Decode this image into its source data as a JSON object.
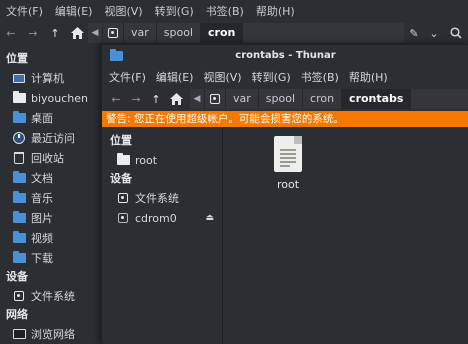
{
  "back_window": {
    "menu": [
      "文件(F)",
      "编辑(E)",
      "视图(V)",
      "转到(G)",
      "书签(B)",
      "帮助(H)"
    ],
    "path": [
      "var",
      "spool",
      "cron"
    ],
    "sidebar": {
      "places_title": "位置",
      "places": [
        {
          "label": "计算机",
          "icon": "computer-icon"
        },
        {
          "label": "biyouchen",
          "icon": "home-folder-icon"
        },
        {
          "label": "桌面",
          "icon": "desktop-folder-icon"
        },
        {
          "label": "最近访问",
          "icon": "recent-icon"
        },
        {
          "label": "回收站",
          "icon": "trash-icon"
        },
        {
          "label": "文档",
          "icon": "documents-folder-icon"
        },
        {
          "label": "音乐",
          "icon": "music-folder-icon"
        },
        {
          "label": "图片",
          "icon": "pictures-folder-icon"
        },
        {
          "label": "视频",
          "icon": "videos-folder-icon"
        },
        {
          "label": "下载",
          "icon": "downloads-folder-icon"
        }
      ],
      "devices_title": "设备",
      "devices": [
        {
          "label": "文件系统",
          "icon": "filesystem-icon"
        }
      ],
      "network_title": "网络",
      "network": [
        {
          "label": "浏览网络",
          "icon": "network-icon"
        }
      ]
    }
  },
  "front_window": {
    "title": "crontabs - Thunar",
    "menu": [
      "文件(F)",
      "编辑(E)",
      "视图(V)",
      "转到(G)",
      "书签(B)",
      "帮助(H)"
    ],
    "path": [
      "var",
      "spool",
      "cron",
      "crontabs"
    ],
    "warning": "警告: 您正在使用超级帐户。可能会损害您的系统。",
    "sidebar": {
      "places_title": "位置",
      "places": [
        {
          "label": "root",
          "icon": "home-folder-icon"
        }
      ],
      "devices_title": "设备",
      "devices": [
        {
          "label": "文件系统",
          "icon": "filesystem-icon"
        },
        {
          "label": "cdrom0",
          "icon": "cdrom-icon"
        }
      ]
    },
    "files": [
      {
        "name": "root",
        "icon": "text-file-icon"
      }
    ]
  },
  "colors": {
    "background": "#2b2e33",
    "warning": "#f57900",
    "folder_accent": "#4a90d9"
  }
}
